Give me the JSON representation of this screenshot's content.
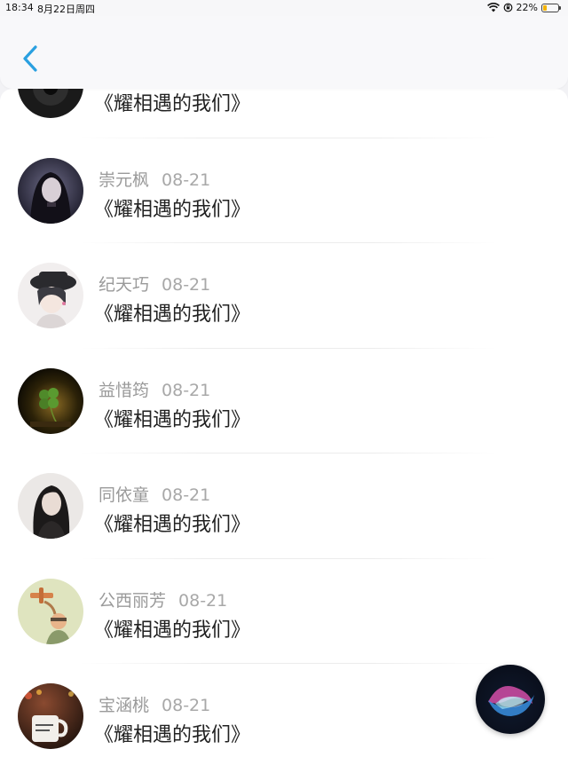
{
  "status_bar": {
    "time": "18:34",
    "date": "8月22日周四",
    "battery_text": "22%",
    "battery_level": 0.22
  },
  "nav": {
    "back_icon": "chevron-left-icon",
    "accent": "#2aa0e0"
  },
  "comments": [
    {
      "name": "",
      "date": "",
      "text": "《耀相遇的我们》"
    },
    {
      "name": "崇元枫",
      "date": "08-21",
      "text": "《耀相遇的我们》"
    },
    {
      "name": "纪天巧",
      "date": "08-21",
      "text": "《耀相遇的我们》"
    },
    {
      "name": "益惜筠",
      "date": "08-21",
      "text": "《耀相遇的我们》"
    },
    {
      "name": "同依童",
      "date": "08-21",
      "text": "《耀相遇的我们》"
    },
    {
      "name": "公西丽芳",
      "date": "08-21",
      "text": "《耀相遇的我们》"
    },
    {
      "name": "宝涵桃",
      "date": "08-21",
      "text": "《耀相遇的我们》"
    }
  ],
  "siri_icon": "siri-icon"
}
